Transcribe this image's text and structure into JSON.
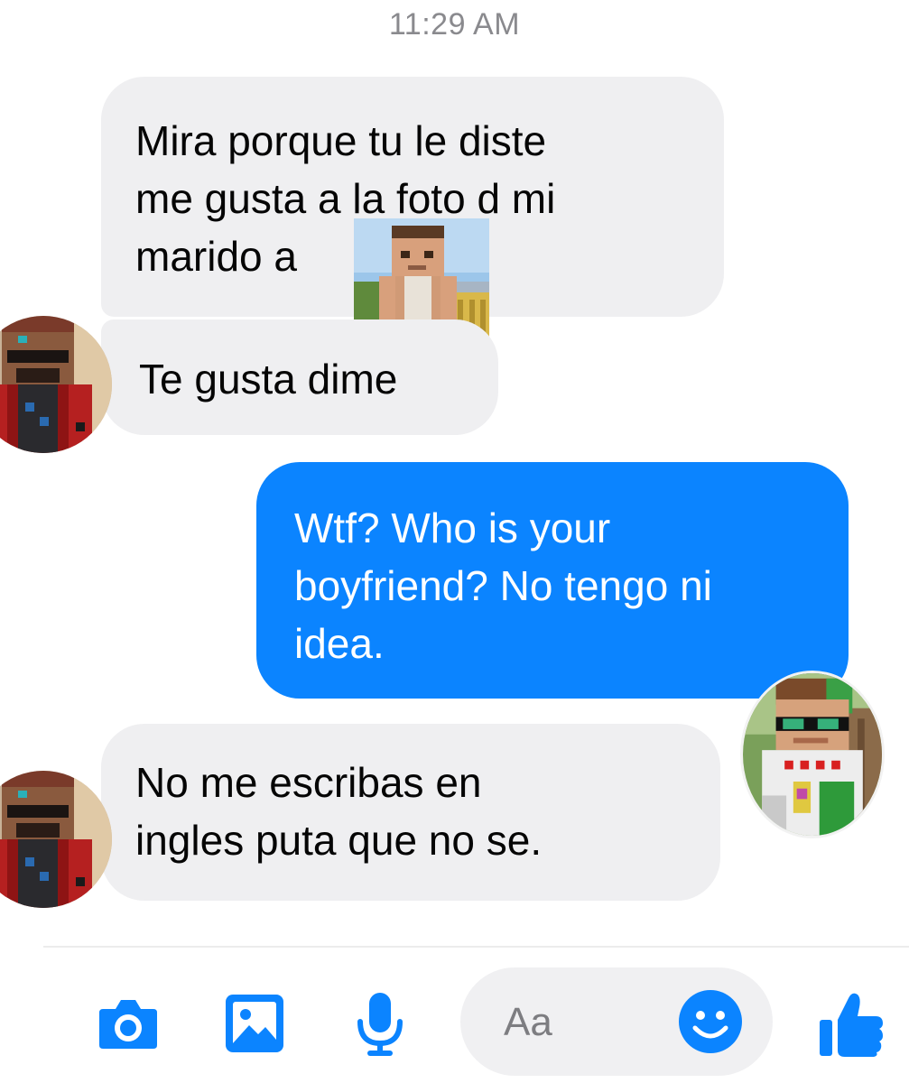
{
  "timestamp": "11:29 AM",
  "messages": [
    {
      "sender": "other",
      "lines": [
        "Mira porque tu le diste",
        "me gusta a la foto d mi",
        "marido a"
      ]
    },
    {
      "sender": "other",
      "lines": [
        "Te gusta dime"
      ]
    },
    {
      "sender": "me",
      "lines": [
        "Wtf?  Who is your",
        "boyfriend? No tengo ni",
        "idea."
      ]
    },
    {
      "sender": "other",
      "lines": [
        "No me escribas en",
        "ingles puta que no se."
      ]
    }
  ],
  "composer": {
    "placeholder": "Aa"
  },
  "icons": {
    "camera": "camera-icon",
    "image": "image-icon",
    "mic": "microphone-icon",
    "emoji": "emoji-icon",
    "like": "thumbs-up-icon"
  },
  "colors": {
    "accent": "#0b84ff",
    "incoming_bubble": "#efeff1",
    "outgoing_bubble": "#0b84ff",
    "timestamp": "#8a8a8e"
  }
}
